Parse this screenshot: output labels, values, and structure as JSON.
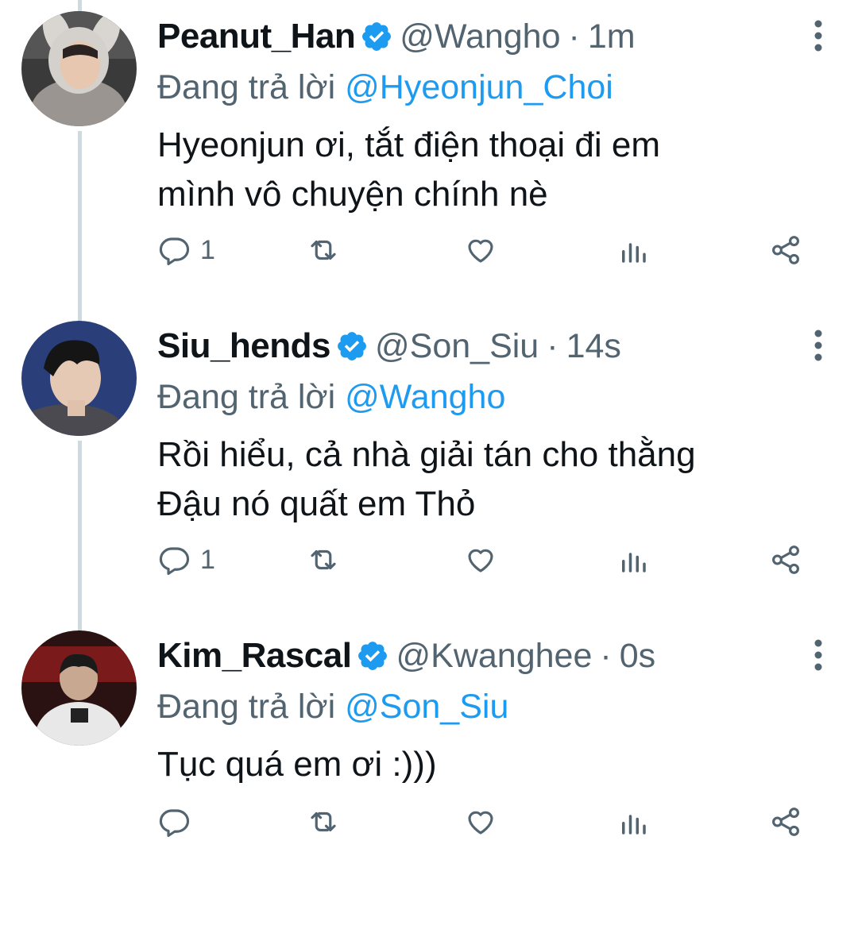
{
  "colors": {
    "link": "#1d9bf0",
    "secondary": "#536471",
    "text": "#0f1419",
    "thread_line": "#cfd9de"
  },
  "tweets": [
    {
      "name": "Peanut_Han",
      "handle": "@Wangho",
      "separator": "·",
      "time": "1m",
      "reply_prefix": "Đang trả lời",
      "reply_mention": "@Hyeonjun_Choi",
      "text_lines": [
        "Hyeonjun ơi, tắt điện thoại đi em",
        "mình vô chuyện chính nè"
      ],
      "reply_count": "1",
      "avatar_icon": "profile-photo-bunny-hood"
    },
    {
      "name": "Siu_hends",
      "handle": "@Son_Siu",
      "separator": "·",
      "time": "14s",
      "reply_prefix": "Đang trả lời",
      "reply_mention": "@Wangho",
      "text_lines": [
        "Rồi hiểu, cả nhà giải tán cho thằng",
        "Đậu nó quất em Thỏ"
      ],
      "reply_count": "1",
      "avatar_icon": "profile-photo-side-profile"
    },
    {
      "name": "Kim_Rascal",
      "handle": "@Kwanghee",
      "separator": "·",
      "time": "0s",
      "reply_prefix": "Đang trả lời",
      "reply_mention": "@Son_Siu",
      "text_lines": [
        "Tục quá em ơi :)))"
      ],
      "reply_count": "",
      "avatar_icon": "profile-photo-stage"
    }
  ]
}
